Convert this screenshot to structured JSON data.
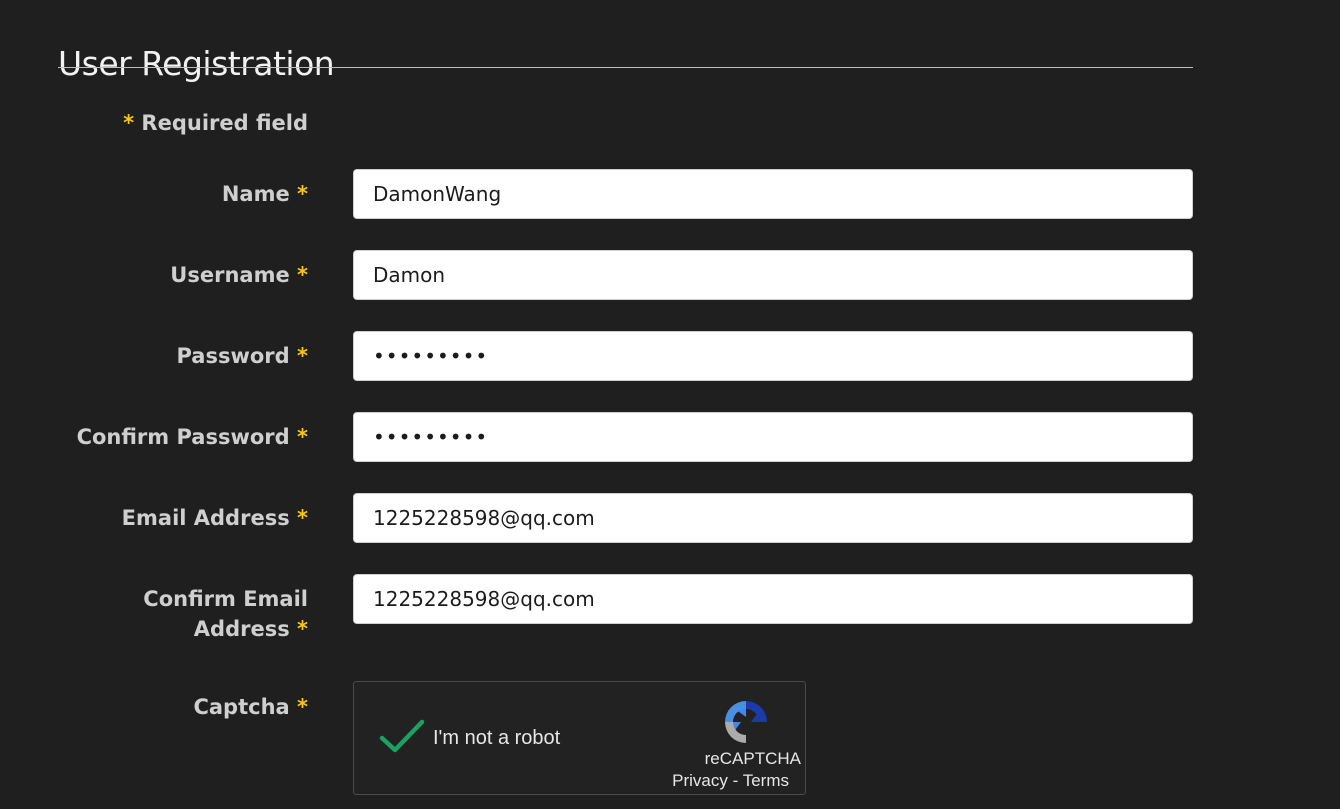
{
  "header": {
    "title": "User Registration"
  },
  "form": {
    "required_note": "Required field",
    "required_marker": "*",
    "fields": {
      "name": {
        "label": "Name",
        "value": "DamonWang"
      },
      "username": {
        "label": "Username",
        "value": "Damon"
      },
      "password": {
        "label": "Password",
        "value": "password1"
      },
      "confirm_password": {
        "label": "Confirm Password",
        "value": "password1"
      },
      "email": {
        "label": "Email Address",
        "value": "1225228598@qq.com"
      },
      "confirm_email": {
        "label_line1": "Confirm Email",
        "label_line2": "Address",
        "value": "1225228598@qq.com"
      }
    },
    "captcha": {
      "label": "Captcha",
      "checkbox_label": "I'm not a robot",
      "checked": true,
      "brand": "reCAPTCHA",
      "privacy_link": "Privacy",
      "separator": "-",
      "terms_link": "Terms"
    }
  },
  "colors": {
    "background": "#1f1f1f",
    "label_text": "#cfcfcf",
    "required_star": "#f5c518",
    "check_green": "#1aa260",
    "field_background": "#ffffff"
  },
  "icons": {
    "check": "check-icon",
    "recaptcha": "recaptcha-logo-icon"
  }
}
